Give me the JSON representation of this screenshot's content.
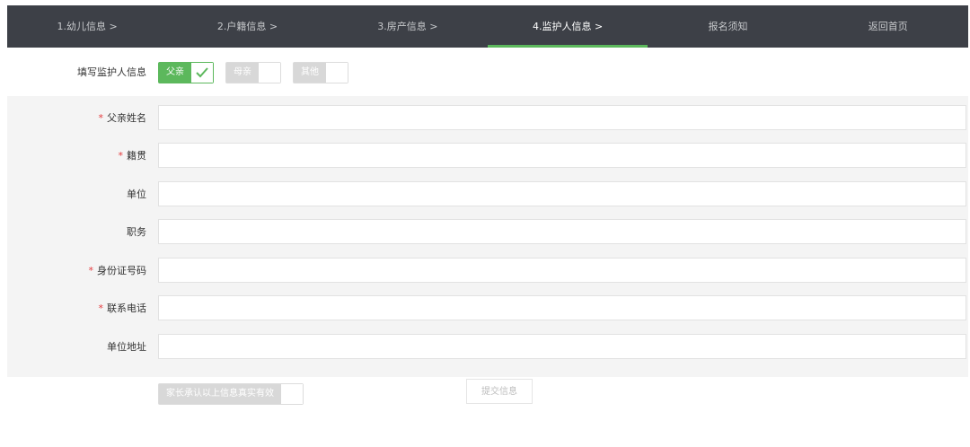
{
  "nav": {
    "items": [
      {
        "label": "1.幼儿信息 >"
      },
      {
        "label": "2.户籍信息 >"
      },
      {
        "label": "3.房产信息 >"
      },
      {
        "label": "4.监护人信息 >"
      },
      {
        "label": "报名须知"
      },
      {
        "label": "返回首页"
      }
    ],
    "active_index": 3
  },
  "guardian": {
    "label": "填写监护人信息",
    "options": [
      {
        "label": "父亲",
        "checked": true
      },
      {
        "label": "母亲",
        "checked": false
      },
      {
        "label": "其他",
        "checked": false
      }
    ]
  },
  "form": {
    "required_mark": "*",
    "fields": [
      {
        "label": "父亲姓名",
        "required": true,
        "value": "",
        "placeholder": ""
      },
      {
        "label": "籍贯",
        "required": true,
        "value": "",
        "placeholder": ""
      },
      {
        "label": "单位",
        "required": false,
        "value": "",
        "placeholder": ""
      },
      {
        "label": "职务",
        "required": false,
        "value": "",
        "placeholder": ""
      },
      {
        "label": "身份证号码",
        "required": true,
        "value": "",
        "placeholder": ""
      },
      {
        "label": "联系电话",
        "required": true,
        "value": "",
        "placeholder": ""
      },
      {
        "label": "单位地址",
        "required": false,
        "value": "",
        "placeholder": ""
      }
    ]
  },
  "confirm": {
    "label": "家长承认以上信息真实有效",
    "checked": false
  },
  "submit": {
    "label": "提交信息"
  },
  "colors": {
    "nav_bg": "#3d4047",
    "accent": "#5cb85c",
    "required": "#e4393c"
  }
}
